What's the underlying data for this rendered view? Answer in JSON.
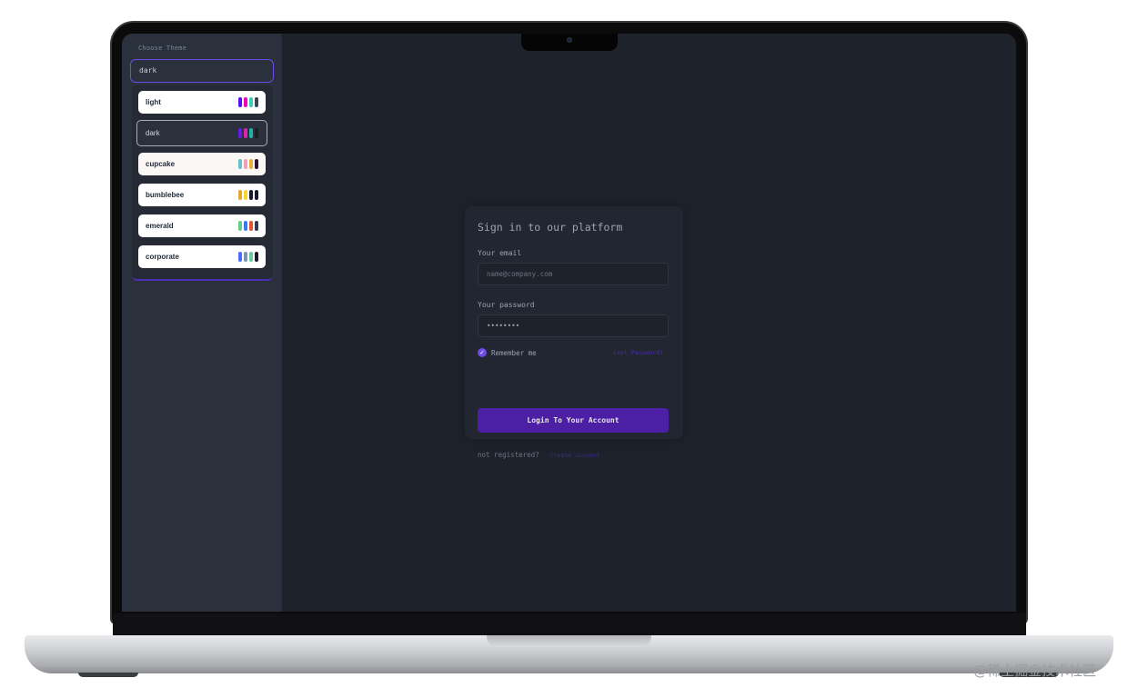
{
  "theme_picker": {
    "label": "Choose Theme",
    "selected_value": "dark",
    "options": [
      {
        "name": "light",
        "swatches": [
          "#570df8",
          "#f000b8",
          "#37cdbe",
          "#3d4451"
        ]
      },
      {
        "name": "dark",
        "swatches": [
          "#661ae6",
          "#d926aa",
          "#1fb2a5",
          "#191d24"
        ]
      },
      {
        "name": "cupcake",
        "swatches": [
          "#65c3c8",
          "#ef9fbc",
          "#eeaf3a",
          "#291334"
        ]
      },
      {
        "name": "bumblebee",
        "swatches": [
          "#e0a82e",
          "#f9d72f",
          "#181830",
          "#181830"
        ]
      },
      {
        "name": "emerald",
        "swatches": [
          "#66cc8a",
          "#377cfb",
          "#ea5234",
          "#333c4d"
        ]
      },
      {
        "name": "corporate",
        "swatches": [
          "#4b6bfb",
          "#7b92b2",
          "#67cba0",
          "#181a2a"
        ]
      }
    ]
  },
  "login": {
    "title": "Sign in to our platform",
    "email_label": "Your email",
    "email_placeholder": "name@company.com",
    "password_label": "Your password",
    "password_value": "••••••••",
    "remember_label": "Remember me",
    "remember_checked": true,
    "forgot_link": "Lost Password?",
    "submit_label": "Login To Your Account",
    "not_registered_text": "not registered?",
    "create_account_link": "Create account"
  },
  "icons": {
    "checkbox": "check-icon"
  },
  "colors": {
    "accent": "#6d4ce6",
    "button": "#4c1fa5",
    "screen_bg": "#1e222b",
    "sidebar_bg": "#2a303c"
  },
  "watermark": "@稀土掘金技术社区"
}
